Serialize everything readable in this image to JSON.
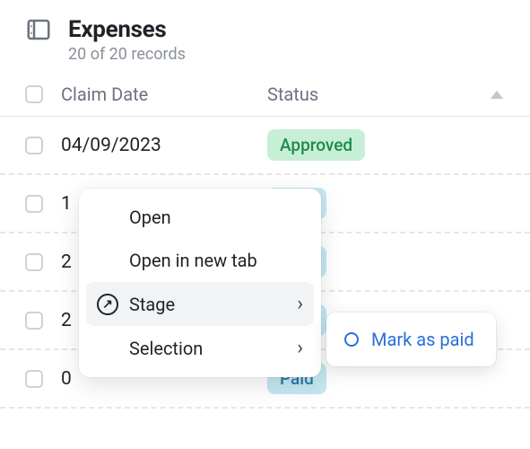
{
  "header": {
    "title": "Expenses",
    "subtitle": "20 of 20 records"
  },
  "columns": {
    "claim_date": "Claim Date",
    "status": "Status"
  },
  "status_labels": {
    "approved": "Approved",
    "paid": "Paid"
  },
  "rows": [
    {
      "date": "04/09/2023",
      "status": "approved"
    },
    {
      "date": "1",
      "status": "paid"
    },
    {
      "date": "2",
      "status": "paid"
    },
    {
      "date": "2",
      "status": "paid"
    },
    {
      "date": "0",
      "status": "paid"
    }
  ],
  "context_menu": {
    "open": "Open",
    "open_new_tab": "Open in new tab",
    "stage": "Stage",
    "selection": "Selection"
  },
  "submenu": {
    "mark_as_paid": "Mark as paid"
  }
}
